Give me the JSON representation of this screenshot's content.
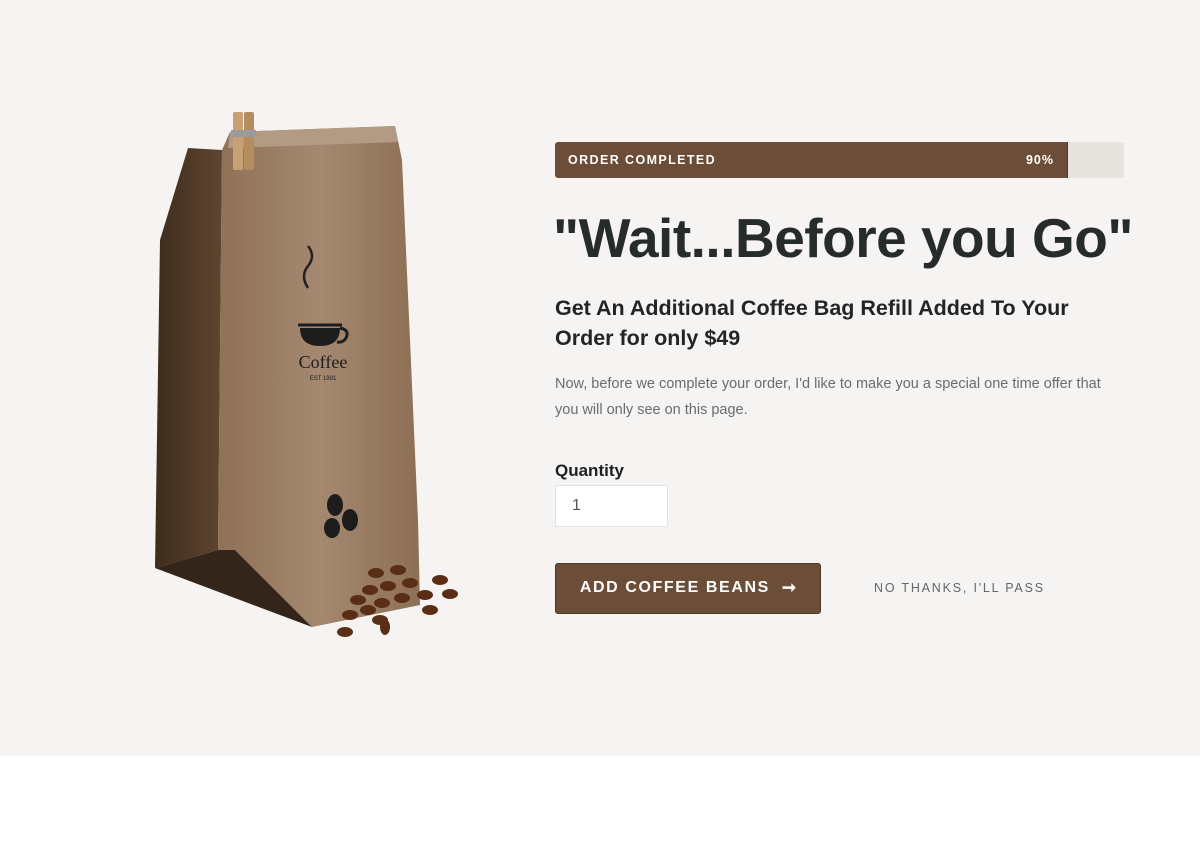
{
  "progress": {
    "label": "ORDER COMPLETED",
    "percent_text": "90%",
    "value": 0.9
  },
  "headline": "\"Wait...Before you Go\"",
  "subheadline": "Get An Additional Coffee Bag Refill Added To Your Order for only $49",
  "description": "Now, before we complete your order, I'd like to make you a special one time offer that you will only see on this page.",
  "quantity": {
    "label": "Quantity",
    "value": "1"
  },
  "cta": {
    "label": "ADD COFFEE BEANS",
    "arrow": "➞"
  },
  "decline": {
    "label": "NO THANKS, I'LL PASS"
  },
  "product_image": {
    "brand_text": "Coffee",
    "est_text": "EST 1991"
  },
  "colors": {
    "accent": "#6c4d37",
    "hero_bg": "#f6f4f2",
    "progress_track": "#e7e3df",
    "heading": "#262b2b"
  }
}
